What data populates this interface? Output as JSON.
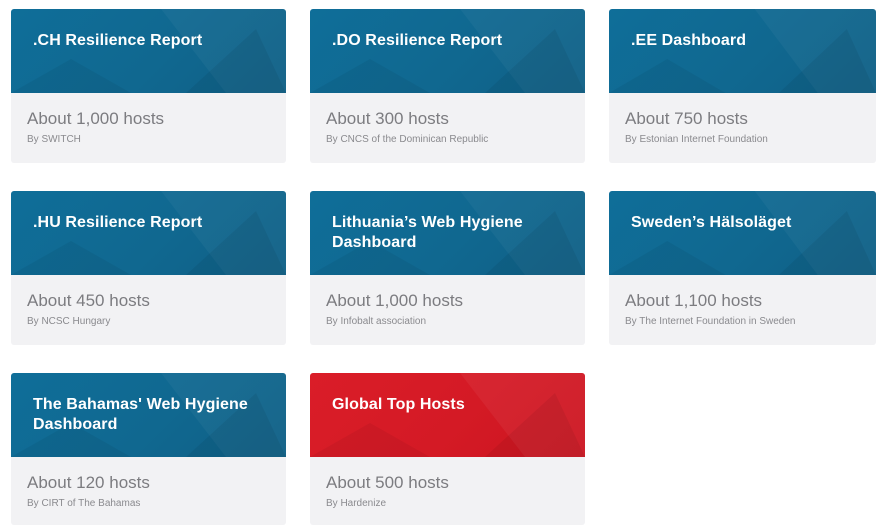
{
  "colors": {
    "card_blue": "#106e95",
    "card_red": "#d91b26",
    "card_body_bg": "#f2f2f4",
    "title_text": "#ffffff",
    "hosts_text": "#7c7c80"
  },
  "cards": [
    {
      "title": ".CH Resilience Report",
      "hosts": "About 1,000 hosts",
      "by": "By SWITCH",
      "color": "blue"
    },
    {
      "title": ".DO Resilience Report",
      "hosts": "About 300 hosts",
      "by": "By CNCS of the Dominican Republic",
      "color": "blue"
    },
    {
      "title": ".EE Dashboard",
      "hosts": "About 750 hosts",
      "by": "By Estonian Internet Foundation",
      "color": "blue"
    },
    {
      "title": ".HU Resilience Report",
      "hosts": "About 450 hosts",
      "by": "By NCSC Hungary",
      "color": "blue"
    },
    {
      "title": "Lithuania’s Web Hygiene Dashboard",
      "hosts": "About 1,000 hosts",
      "by": "By Infobalt association",
      "color": "blue"
    },
    {
      "title": "Sweden’s Hälsoläget",
      "hosts": "About 1,100 hosts",
      "by": "By The Internet Foundation in Sweden",
      "color": "blue"
    },
    {
      "title": "The Bahamas' Web Hygiene Dashboard",
      "hosts": "About 120 hosts",
      "by": "By CIRT of The Bahamas",
      "color": "blue"
    },
    {
      "title": "Global Top Hosts",
      "hosts": "About 500 hosts",
      "by": "By Hardenize",
      "color": "red"
    }
  ]
}
